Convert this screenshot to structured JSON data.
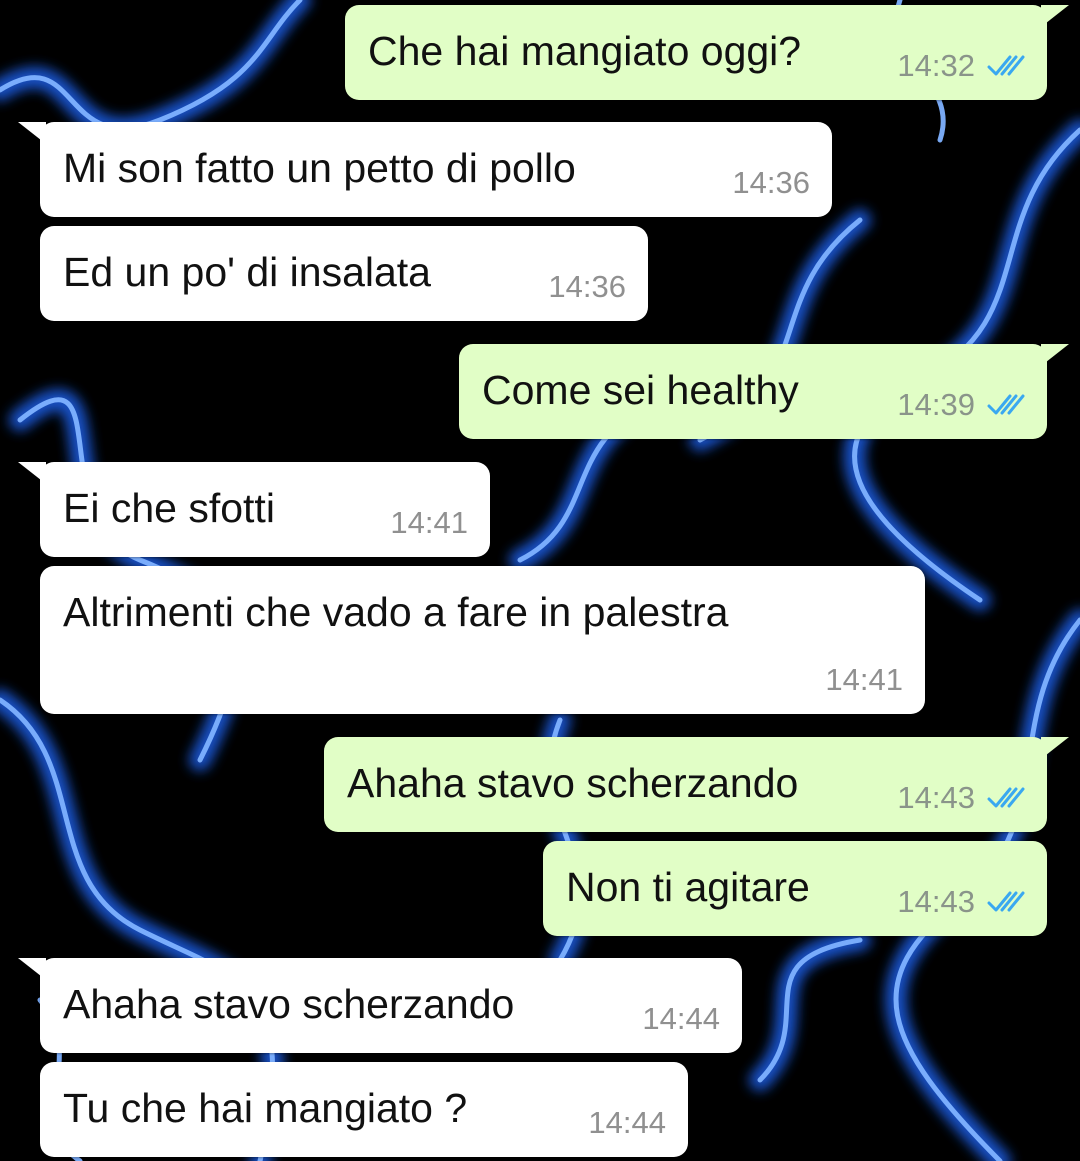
{
  "chat": {
    "messages": [
      {
        "direction": "outgoing",
        "text": "Che hai mangiato oggi?",
        "time": "14:32",
        "status": "read"
      },
      {
        "direction": "incoming",
        "text": "Mi son fatto un petto di pollo",
        "time": "14:36"
      },
      {
        "direction": "incoming",
        "text": "Ed un po' di insalata",
        "time": "14:36"
      },
      {
        "direction": "outgoing",
        "text": "Come sei healthy",
        "time": "14:39",
        "status": "read"
      },
      {
        "direction": "incoming",
        "text": "Ei che sfotti",
        "time": "14:41"
      },
      {
        "direction": "incoming",
        "text": "Altrimenti che vado a fare in palestra",
        "time": "14:41"
      },
      {
        "direction": "outgoing",
        "text": "Ahaha stavo scherzando",
        "time": "14:43",
        "status": "read"
      },
      {
        "direction": "outgoing",
        "text": "Non ti agitare",
        "time": "14:43",
        "status": "read"
      },
      {
        "direction": "incoming",
        "text": "Ahaha stavo scherzando",
        "time": "14:44"
      },
      {
        "direction": "incoming",
        "text": "Tu che hai mangiato ?",
        "time": "14:44"
      }
    ]
  },
  "colors": {
    "outgoing_bubble": "#e1fec6",
    "incoming_bubble": "#ffffff",
    "read_tick": "#3aa8f0",
    "wallpaper_flame": "#1e6cff"
  },
  "icons": {
    "read_receipt": "double-check-icon"
  }
}
